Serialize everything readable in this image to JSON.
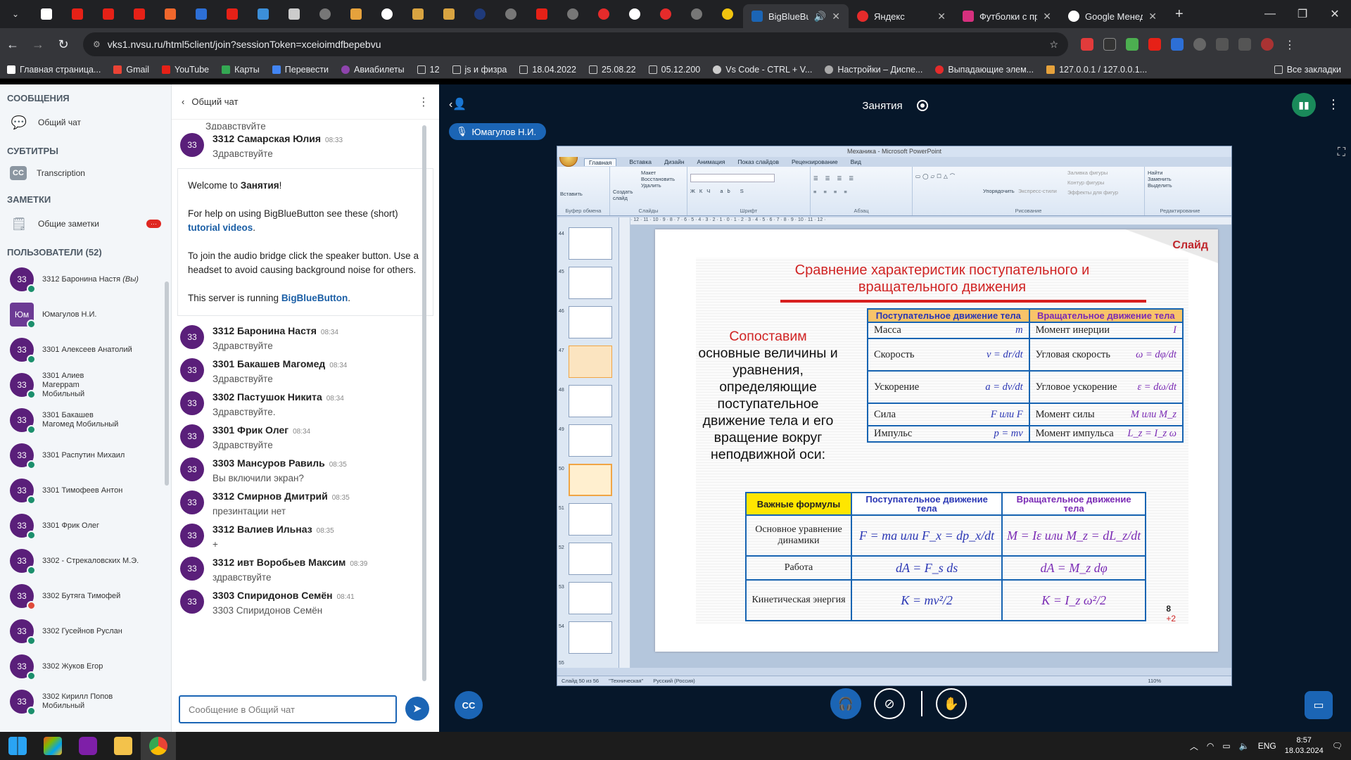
{
  "browser": {
    "active_tab_title": "BigBlueButton",
    "tab2_title": "Яндекс",
    "tab3_title": "Футболки с пр",
    "tab4_title": "Google Менедж",
    "url": "vks1.nvsu.ru/html5client/join?sessionToken=xceioimdfbepebvu",
    "new_tab": "+"
  },
  "bookmarks": [
    "Главная страница...",
    "Gmail",
    "YouTube",
    "Карты",
    "Перевести",
    "Авиабилеты",
    "12",
    "js и физра",
    "18.04.2022",
    "25.08.22",
    "05.12.200",
    "Vs Code - CTRL + V...",
    "Настройки – Диспе...",
    "Выпадающие элем...",
    "127.0.0.1 / 127.0.0.1..."
  ],
  "bookmarks_all": "Все закладки",
  "sidebar": {
    "messages_title": "СООБЩЕНИЯ",
    "public_chat": "Общий чат",
    "captions_title": "СУБТИТРЫ",
    "transcription": "Transcription",
    "notes_title": "ЗАМЕТКИ",
    "shared_notes": "Общие заметки",
    "notes_badge": "···",
    "users_title": "ПОЛЬЗОВАТЕЛИ (52)",
    "users": [
      {
        "initials": "33",
        "name": "3312 Баронина Настя",
        "suffix": "(Вы)"
      },
      {
        "initials": "Юм",
        "name": "Юмагулов Н.И.",
        "suffix": ""
      },
      {
        "initials": "33",
        "name": "3301 Алексеев Анатолий",
        "suffix": ""
      },
      {
        "initials": "33",
        "name": "3301 Алиев Магерраm Мобильный",
        "suffix": ""
      },
      {
        "initials": "33",
        "name": "3301 Бакашев Магомед Мобильный",
        "suffix": ""
      },
      {
        "initials": "33",
        "name": "3301 Распутин Михаил",
        "suffix": ""
      },
      {
        "initials": "33",
        "name": "3301 Тимофеев Антон",
        "suffix": ""
      },
      {
        "initials": "33",
        "name": "3301 Фрик Олег",
        "suffix": ""
      },
      {
        "initials": "33",
        "name": "3302 - Стрекаловских М.Э.",
        "suffix": ""
      },
      {
        "initials": "33",
        "name": "3302 Бутяга Тимофей",
        "suffix": ""
      },
      {
        "initials": "33",
        "name": "3302 Гусейнов Руслан",
        "suffix": ""
      },
      {
        "initials": "33",
        "name": "3302 Жуков Егор",
        "suffix": ""
      },
      {
        "initials": "33",
        "name": "3302 Кирилл Попов Мобильный",
        "suffix": ""
      }
    ]
  },
  "chat": {
    "title": "Общий чат",
    "top_cut_text": "Здравствуйте",
    "first": {
      "initials": "33",
      "name": "3312 Самарская Юлия",
      "time": "08:33",
      "text": "Здравствуйте"
    },
    "welcome": {
      "l1_pre": "Welcome to ",
      "l1_bold": "Занятия",
      "l1_post": "!",
      "l2_pre": "For help on using BigBlueButton see these (short) ",
      "l2_link": "tutorial videos",
      "l2_post": ".",
      "l3": "To join the audio bridge click the speaker button. Use a headset to avoid causing background noise for others.",
      "l4_pre": "This server is running ",
      "l4_link": "BigBlueButton",
      "l4_post": "."
    },
    "messages": [
      {
        "initials": "33",
        "name": "3312 Баронина Настя",
        "time": "08:34",
        "text": "Здравствуйте"
      },
      {
        "initials": "33",
        "name": "3301 Бакашев Магомед",
        "time": "08:34",
        "text": "Здравствуйте"
      },
      {
        "initials": "33",
        "name": "3302 Пастушок Никита",
        "time": "08:34",
        "text": "Здравствуйте."
      },
      {
        "initials": "33",
        "name": "3301 Фрик Олег",
        "time": "08:34",
        "text": "Здравствуйте"
      },
      {
        "initials": "33",
        "name": "3303 Мансуров Равиль",
        "time": "08:35",
        "text": "Вы включили экран?"
      },
      {
        "initials": "33",
        "name": "3312 Смирнов Дмитрий",
        "time": "08:35",
        "text": "презинтации нет"
      },
      {
        "initials": "33",
        "name": "3312 Валиев Ильназ",
        "time": "08:35",
        "text": "+"
      },
      {
        "initials": "33",
        "name": "3312 ивт Воробьев Максим",
        "time": "08:39",
        "text": "здравствуйте"
      },
      {
        "initials": "33",
        "name": "3303 Спиридонов Семён",
        "time": "08:41",
        "text": "3303 Спиридонов Семён"
      }
    ],
    "input_placeholder": "Сообщение в Общий чат"
  },
  "main": {
    "meeting_title": "Занятия",
    "presenter": "Юмагулов Н.И."
  },
  "ppt": {
    "window_title": "Механика - Microsoft PowerPoint",
    "tabs": [
      "Главная",
      "Вставка",
      "Дизайн",
      "Анимация",
      "Показ слайдов",
      "Рецензирование",
      "Вид"
    ],
    "groups": [
      "Буфер обмена",
      "Слайды",
      "Шрифт",
      "Абзац",
      "Рисование",
      "Редактирование"
    ],
    "ribbon_labels": {
      "paste": "Вставить",
      "create": "Создать слайд",
      "layout": "Макет",
      "restore": "Восстановить",
      "delete": "Удалить",
      "arrange": "Упорядочить",
      "styles": "Экспресс-стили",
      "fill": "Заливка фигуры",
      "outline": "Контур фигуры",
      "effects": "Эффекты для фигур",
      "find": "Найти",
      "replace": "Заменить",
      "select": "Выделить"
    },
    "thumb_numbers": [
      "44",
      "45",
      "46",
      "47",
      "48",
      "49",
      "50",
      "51",
      "52",
      "53",
      "54",
      "55"
    ],
    "status_slide": "Слайд 50 из 56",
    "status_theme": "\"Техническая\"",
    "status_lang": "Русский (Россия)",
    "status_zoom": "110%",
    "ruler": "· 12 · 11 · 10 · 9 · 8 · 7 · 6 · 5 · 4 · 3 · 2 · 1 · 0 · 1 · 2 · 3 · 4 · 5 · 6 · 7 · 8 · 9 · 10 · 11 · 12 ·"
  },
  "slide": {
    "label": "Слайд",
    "title": "Сравнение характеристик поступательного и вращательного движения",
    "compare_red": "Сопоставим",
    "compare_text": "основные величины и уравнения, определяющие поступательное движение тела и его вращение вокруг неподвижной оси:",
    "t1_head": [
      "Поступательное движение тела",
      "Вращательное движение тела"
    ],
    "t1_rows": [
      {
        "l": "Масса",
        "lf": "m",
        "r": "Момент инерции",
        "rf": "I"
      },
      {
        "l": "Скорость",
        "lf": "v = dr/dt",
        "r": "Угловая скорость",
        "rf": "ω = dφ/dt"
      },
      {
        "l": "Ускорение",
        "lf": "a = dv/dt",
        "r": "Угловое ускорение",
        "rf": "ε = dω/dt"
      },
      {
        "l": "Сила",
        "lf": "F или F",
        "r": "Момент силы",
        "rf": "M или M_z"
      },
      {
        "l": "Импульс",
        "lf": "p = mv",
        "r": "Момент импульса",
        "rf": "L_z = I_z ω"
      }
    ],
    "t2_head": [
      "Важные формулы",
      "Поступательное движение тела",
      "Вращательное движение тела"
    ],
    "t2_rows": [
      {
        "name": "Основное уравнение динамики",
        "a": "F = ma  или  F_x = dp_x/dt",
        "b": "M = Iε  или  M_z = dL_z/dt"
      },
      {
        "name": "Работа",
        "a": "dA = F_s ds",
        "b": "dA = M_z dφ"
      },
      {
        "name": "Кинетическая энергия",
        "a": "K = mv²/2",
        "b": "K = I_z ω²/2"
      }
    ],
    "page_num": "8",
    "page_sub": "+2"
  },
  "taskbar": {
    "lang": "ENG",
    "time": "8:57",
    "date": "18.03.2024"
  }
}
